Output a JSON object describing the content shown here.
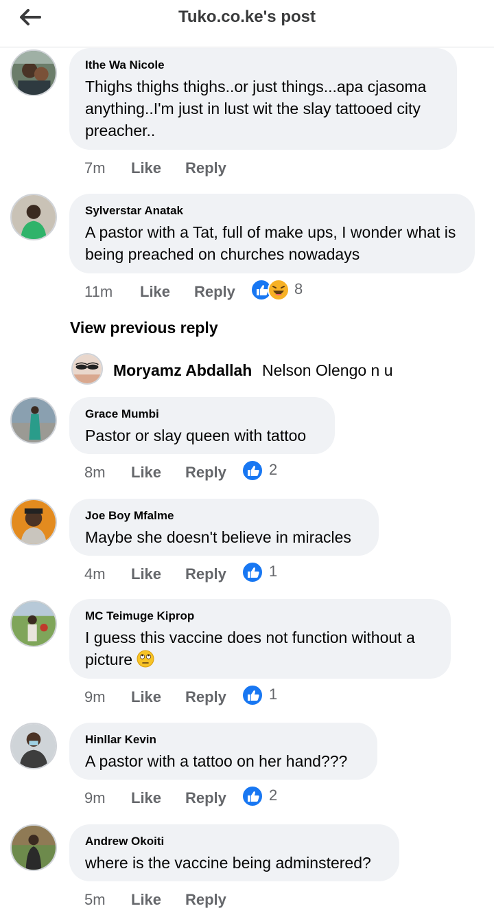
{
  "header": {
    "title": "Tuko.co.ke's post",
    "back_icon": "arrow-left-icon"
  },
  "comments": [
    {
      "author": "Ithe Wa Nicole",
      "text": "Thighs thighs thighs..or just things...apa cjasoma anything..I'm just in lust wit the slay tattooed city preacher..",
      "time": "7m",
      "like_label": "Like",
      "reply_label": "Reply"
    },
    {
      "author": "Sylverstar Anatak",
      "text": "A pastor with a Tat, full of make ups, I wonder what is being preached on churches nowadays",
      "time": "11m",
      "like_label": "Like",
      "reply_label": "Reply",
      "reactions": [
        "like-icon",
        "haha-icon"
      ],
      "reaction_count": "8"
    },
    {
      "author": "Grace Mumbi",
      "text": "Pastor or slay queen with tattoo",
      "time": "8m",
      "like_label": "Like",
      "reply_label": "Reply",
      "reactions": [
        "like-icon"
      ],
      "reaction_count": "2"
    },
    {
      "author": "Joe Boy Mfalme",
      "text": "Maybe she doesn't believe in miracles",
      "time": "4m",
      "like_label": "Like",
      "reply_label": "Reply",
      "reactions": [
        "like-icon"
      ],
      "reaction_count": "1"
    },
    {
      "author": "MC Teimuge Kiprop",
      "text": "I guess this vaccine does not function without a picture",
      "emoji": "eye-roll-emoji-icon",
      "time": "9m",
      "like_label": "Like",
      "reply_label": "Reply",
      "reactions": [
        "like-icon"
      ],
      "reaction_count": "1"
    },
    {
      "author": "Hinllar Kevin",
      "text": "A pastor with a tattoo on her hand???",
      "time": "9m",
      "like_label": "Like",
      "reply_label": "Reply",
      "reactions": [
        "like-icon"
      ],
      "reaction_count": "2"
    },
    {
      "author": "Andrew Okoiti",
      "text": "where is the vaccine being adminstered?",
      "time": "5m",
      "like_label": "Like",
      "reply_label": "Reply"
    }
  ],
  "view_previous_reply": "View previous reply",
  "reply_preview": {
    "author": "Moryamz Abdallah",
    "text": "Nelson Olengo n u"
  },
  "colors": {
    "like_blue": "#1877f2",
    "bubble_bg": "#f0f2f5",
    "meta_gray": "#65676b"
  }
}
